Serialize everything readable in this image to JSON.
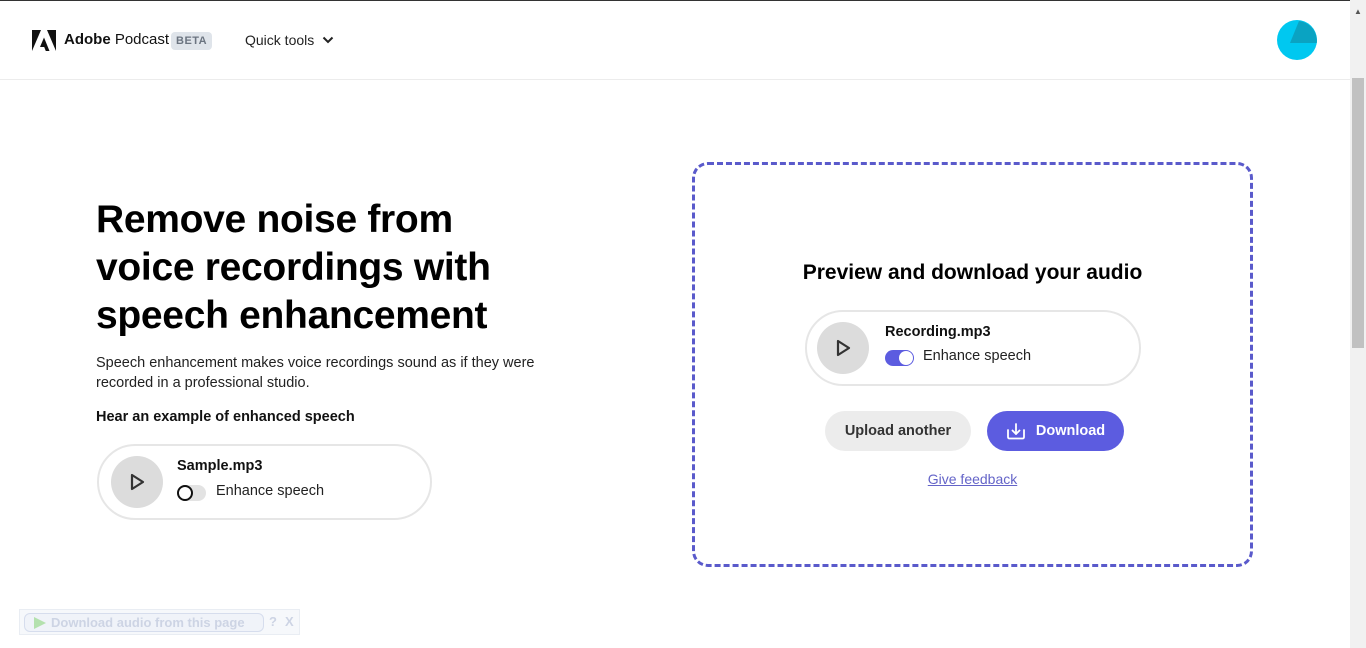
{
  "header": {
    "brand_bold": "Adobe",
    "brand_rest": " Podcast",
    "badge": "BETA",
    "quick_tools_label": "Quick tools",
    "logo_icon": "adobe-logo-icon",
    "avatar_icon": "user-avatar-icon"
  },
  "hero": {
    "title": "Remove noise from voice recordings with speech enhancement",
    "description": "Speech enhancement makes voice recordings sound as if they were recorded in a professional studio.",
    "example_heading": "Hear an example of enhanced speech",
    "sample_player": {
      "filename": "Sample.mp3",
      "toggle_label": "Enhance speech",
      "enhance_on": false
    }
  },
  "preview": {
    "title": "Preview and download your audio",
    "player": {
      "filename": "Recording.mp3",
      "toggle_label": "Enhance speech",
      "enhance_on": true
    },
    "upload_label": "Upload another",
    "download_label": "Download",
    "feedback_label": "Give feedback"
  },
  "extension_bar": {
    "label": "Download audio from this page",
    "help": "?",
    "close": "X"
  },
  "colors": {
    "accent": "#5c5ce0",
    "dashed_border": "#5a5acb",
    "avatar_light": "#00c8f0",
    "avatar_dark": "#0aa3c2"
  }
}
